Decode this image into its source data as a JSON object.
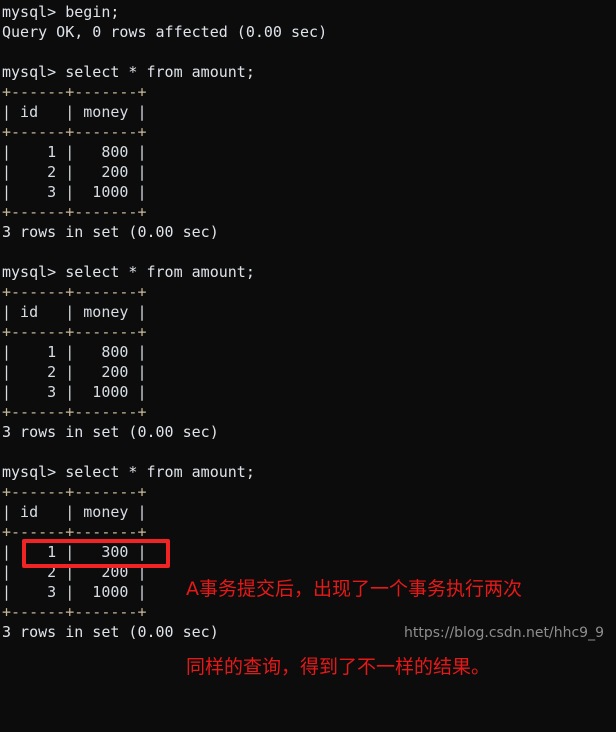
{
  "terminal": {
    "background_color": "#0c0c0c",
    "text_color": "#d8dee4",
    "border_color": "#c8b89a",
    "lines": [
      {
        "kind": "cmd",
        "text": "mysql> begin;"
      },
      {
        "kind": "status",
        "text": "Query OK, 0 rows affected (0.00 sec)"
      },
      {
        "kind": "blank",
        "text": " "
      },
      {
        "kind": "cmd",
        "text": "mysql> select * from amount;"
      },
      {
        "kind": "rule",
        "text": "+------+-------+"
      },
      {
        "kind": "row",
        "text": "| id   | money |"
      },
      {
        "kind": "rule",
        "text": "+------+-------+"
      },
      {
        "kind": "row",
        "text": "|    1 |   800 |"
      },
      {
        "kind": "row",
        "text": "|    2 |   200 |"
      },
      {
        "kind": "row",
        "text": "|    3 |  1000 |"
      },
      {
        "kind": "rule",
        "text": "+------+-------+"
      },
      {
        "kind": "status",
        "text": "3 rows in set (0.00 sec)"
      },
      {
        "kind": "blank",
        "text": " "
      },
      {
        "kind": "cmd",
        "text": "mysql> select * from amount;"
      },
      {
        "kind": "rule",
        "text": "+------+-------+"
      },
      {
        "kind": "row",
        "text": "| id   | money |"
      },
      {
        "kind": "rule",
        "text": "+------+-------+"
      },
      {
        "kind": "row",
        "text": "|    1 |   800 |"
      },
      {
        "kind": "row",
        "text": "|    2 |   200 |"
      },
      {
        "kind": "row",
        "text": "|    3 |  1000 |"
      },
      {
        "kind": "rule",
        "text": "+------+-------+"
      },
      {
        "kind": "status",
        "text": "3 rows in set (0.00 sec)"
      },
      {
        "kind": "blank",
        "text": " "
      },
      {
        "kind": "cmd",
        "text": "mysql> select * from amount;"
      },
      {
        "kind": "rule",
        "text": "+------+-------+"
      },
      {
        "kind": "row",
        "text": "| id   | money |"
      },
      {
        "kind": "rule",
        "text": "+------+-------+"
      },
      {
        "kind": "row",
        "text": "|    1 |   300 |"
      },
      {
        "kind": "row",
        "text": "|    2 |   200 |"
      },
      {
        "kind": "row",
        "text": "|    3 |  1000 |"
      },
      {
        "kind": "rule",
        "text": "+------+-------+"
      },
      {
        "kind": "status",
        "text": "3 rows in set (0.00 sec)"
      }
    ],
    "queries": [
      {
        "command": "begin;",
        "result_text": "Query OK, 0 rows affected (0.00 sec)"
      },
      {
        "command": "select * from amount;",
        "columns": [
          "id",
          "money"
        ],
        "rows": [
          [
            "1",
            "800"
          ],
          [
            "2",
            "200"
          ],
          [
            "3",
            "1000"
          ]
        ],
        "result_text": "3 rows in set (0.00 sec)"
      },
      {
        "command": "select * from amount;",
        "columns": [
          "id",
          "money"
        ],
        "rows": [
          [
            "1",
            "800"
          ],
          [
            "2",
            "200"
          ],
          [
            "3",
            "1000"
          ]
        ],
        "result_text": "3 rows in set (0.00 sec)"
      },
      {
        "command": "select * from amount;",
        "columns": [
          "id",
          "money"
        ],
        "rows": [
          [
            "1",
            "300"
          ],
          [
            "2",
            "200"
          ],
          [
            "3",
            "1000"
          ]
        ],
        "result_text": "3 rows in set (0.00 sec)",
        "highlighted_row": [
          "1",
          "300"
        ]
      }
    ]
  },
  "annotation": {
    "color": "#e61919",
    "line1": "A事务提交后，出现了一个事务执行两次",
    "line2": "同样的查询，得到了不一样的结果。"
  },
  "highlight": {
    "color": "#f02424",
    "target_row": "|    1 |   300 |"
  },
  "watermark": {
    "text": "https://blog.csdn.net/hhc9_9",
    "color": "#8e8e8e"
  }
}
